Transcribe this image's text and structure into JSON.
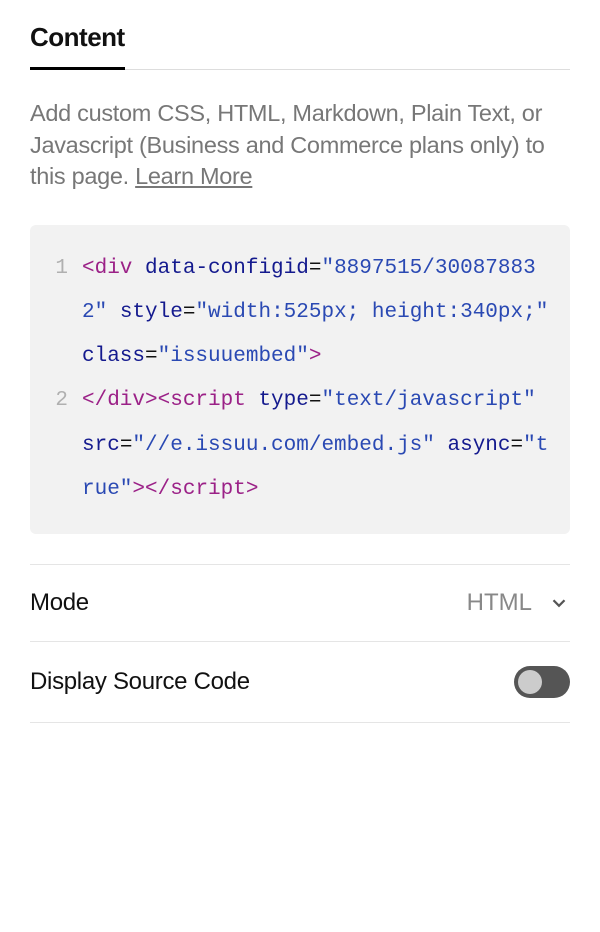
{
  "tab": {
    "content_label": "Content"
  },
  "description": {
    "text": "Add custom CSS, HTML, Markdown, Plain Text, or Javascript (Business and Commerce plans only) to this page. ",
    "link_label": "Learn More"
  },
  "code": {
    "lines": [
      {
        "num": "1",
        "tokens": [
          {
            "t": "<div",
            "c": "c-tag"
          },
          {
            "t": " ",
            "c": ""
          },
          {
            "t": "data-configid",
            "c": "c-attr"
          },
          {
            "t": "=",
            "c": "c-eq"
          },
          {
            "t": "\"8897515/300878832\"",
            "c": "c-str"
          },
          {
            "t": " ",
            "c": ""
          },
          {
            "t": "style",
            "c": "c-attr"
          },
          {
            "t": "=",
            "c": "c-eq"
          },
          {
            "t": "\"width:525px; height:340px;\"",
            "c": "c-str"
          },
          {
            "t": " ",
            "c": ""
          },
          {
            "t": "class",
            "c": "c-attr"
          },
          {
            "t": "=",
            "c": "c-eq"
          },
          {
            "t": "\"issuuembed\"",
            "c": "c-str"
          },
          {
            "t": ">",
            "c": "c-tag"
          }
        ]
      },
      {
        "num": "2",
        "tokens": [
          {
            "t": "</div>",
            "c": "c-tag"
          },
          {
            "t": "<script",
            "c": "c-tag"
          },
          {
            "t": " ",
            "c": ""
          },
          {
            "t": "type",
            "c": "c-attr"
          },
          {
            "t": "=",
            "c": "c-eq"
          },
          {
            "t": "\"text/javascript\"",
            "c": "c-str"
          },
          {
            "t": " ",
            "c": ""
          },
          {
            "t": "src",
            "c": "c-attr"
          },
          {
            "t": "=",
            "c": "c-eq"
          },
          {
            "t": "\"//e.issuu.com/embed.js\"",
            "c": "c-str"
          },
          {
            "t": " ",
            "c": ""
          },
          {
            "t": "async",
            "c": "c-attr"
          },
          {
            "t": "=",
            "c": "c-eq"
          },
          {
            "t": "\"true\"",
            "c": "c-str"
          },
          {
            "t": ">",
            "c": "c-tag"
          },
          {
            "t": "<",
            "c": "c-tag"
          },
          {
            "t": "/script",
            "c": "c-tag"
          },
          {
            "t": ">",
            "c": "c-tag"
          }
        ]
      }
    ]
  },
  "mode": {
    "label": "Mode",
    "value": "HTML"
  },
  "display_source": {
    "label": "Display Source Code",
    "enabled": false
  }
}
